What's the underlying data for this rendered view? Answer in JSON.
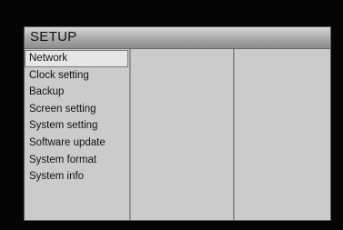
{
  "window": {
    "title": "SETUP"
  },
  "menu": {
    "selected_index": 0,
    "items": [
      {
        "label": "Network"
      },
      {
        "label": "Clock setting"
      },
      {
        "label": "Backup"
      },
      {
        "label": "Screen setting"
      },
      {
        "label": "System setting"
      },
      {
        "label": "Software update"
      },
      {
        "label": "System format"
      },
      {
        "label": "System info"
      }
    ]
  }
}
